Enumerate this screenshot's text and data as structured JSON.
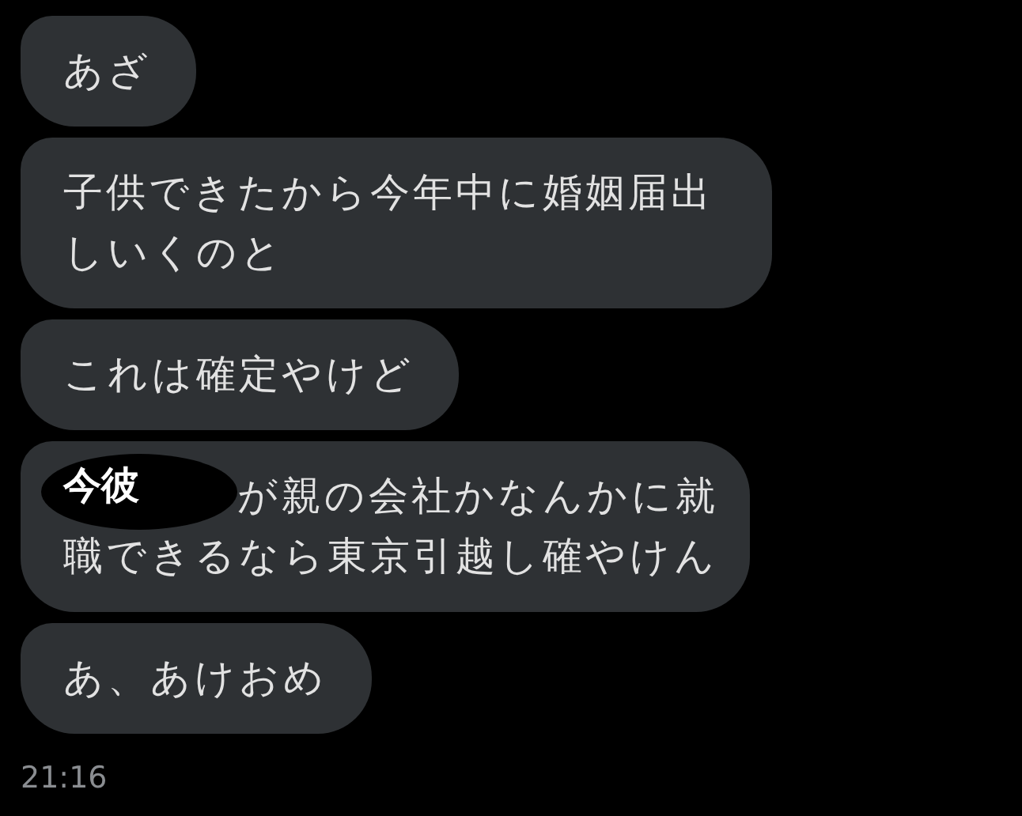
{
  "messages": [
    {
      "text": "あざ"
    },
    {
      "text": "子供できたから今年中に婚姻届出しいくのと"
    },
    {
      "text": "これは確定やけど"
    },
    {
      "redaction": {
        "label": "今彼"
      },
      "lines": [
        "が親の会社かなんかに就",
        "職できるなら東京引越し確やけん"
      ]
    },
    {
      "text": "あ、あけおめ"
    }
  ],
  "timestamp": "21:16"
}
